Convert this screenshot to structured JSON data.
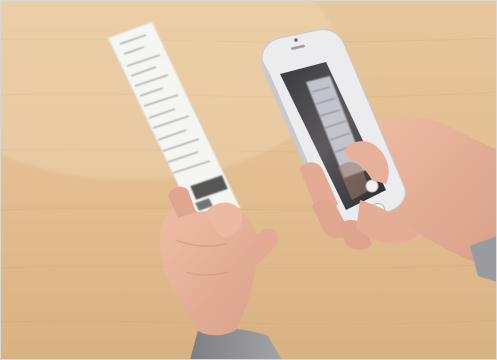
{
  "photo": {
    "colors": {
      "table": "#e2bf94",
      "table_light": "#ecd2ae",
      "table_dark": "#cfa674",
      "skin": "#e7b29a",
      "skin_shadow": "#c98e76",
      "sleeve": "#8f9093",
      "receipt": "#f4f4f1",
      "receipt_ink": "#6c6c6c",
      "phone_body": "#e9e9ec",
      "phone_screen": "#2c2b30"
    }
  }
}
